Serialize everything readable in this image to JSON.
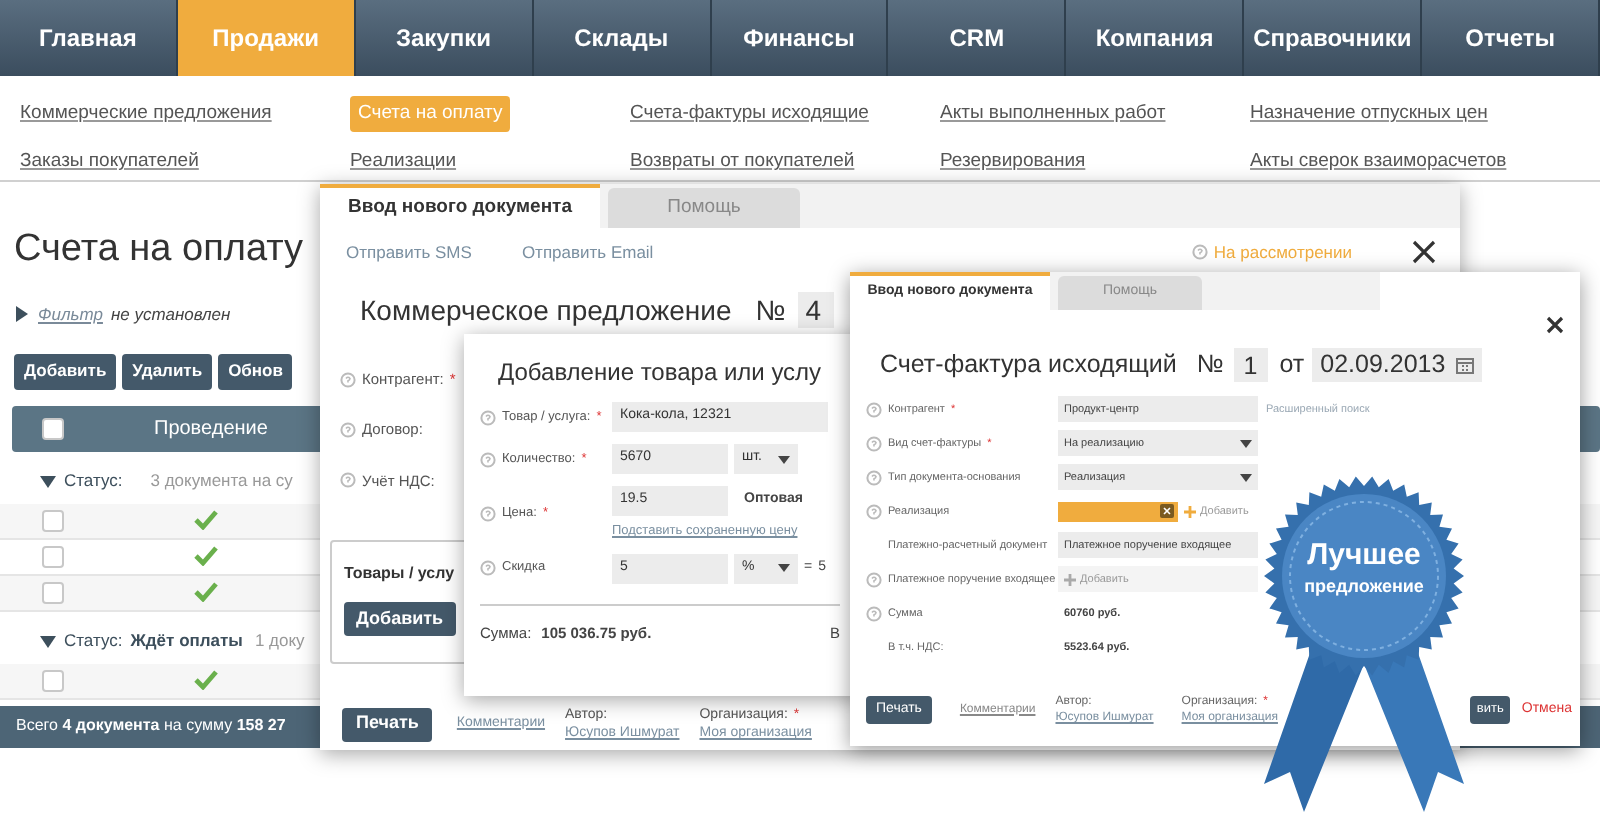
{
  "nav": [
    {
      "label": "Главная",
      "selected": false
    },
    {
      "label": "Продажи",
      "selected": true
    },
    {
      "label": "Закупки",
      "selected": false
    },
    {
      "label": "Склады",
      "selected": false
    },
    {
      "label": "Финансы",
      "selected": false
    },
    {
      "label": "CRM",
      "selected": false
    },
    {
      "label": "Компания",
      "selected": false
    },
    {
      "label": "Справочники",
      "selected": false
    },
    {
      "label": "Отчеты",
      "selected": false
    }
  ],
  "subnav": [
    {
      "label": "Коммерческие предложения",
      "selected": false
    },
    {
      "label": "Счета на оплату",
      "selected": true
    },
    {
      "label": "Счета-фактуры исходящие",
      "selected": false
    },
    {
      "label": "Акты выполненных работ",
      "selected": false
    },
    {
      "label": "Назначение отпускных цен",
      "selected": false
    },
    {
      "label": "Заказы покупателей",
      "selected": false
    },
    {
      "label": "Реализации",
      "selected": false
    },
    {
      "label": "Возвраты от покупателей",
      "selected": false
    },
    {
      "label": "Резервирования",
      "selected": false
    },
    {
      "label": "Акты сверок взаиморасчетов",
      "selected": false
    }
  ],
  "page": {
    "title": "Счета на оплату",
    "filter": {
      "expanded": false,
      "link": "Фильтр",
      "text": "не установлен"
    },
    "buttons": [
      "Добавить",
      "Удалить",
      "Обнов"
    ],
    "table": {
      "header_checked": false,
      "column": "Проведение",
      "groups": [
        {
          "expanded": true,
          "label": "Статус:",
          "summary": "3 документа на су",
          "rows": [
            {
              "checked": false,
              "posted": true
            },
            {
              "checked": false,
              "posted": true
            },
            {
              "checked": false,
              "posted": true
            }
          ]
        },
        {
          "expanded": true,
          "label": "Статус:",
          "value": "Ждёт оплаты",
          "summary": "1 доку",
          "rows": [
            {
              "checked": false,
              "posted": true
            }
          ]
        }
      ]
    },
    "footer": "Всего **4 документа** на сумму **158 27**"
  },
  "offer_window": {
    "tabs": [
      {
        "label": "Ввод нового документа",
        "selected": true
      },
      {
        "label": "Помощь",
        "selected": false
      }
    ],
    "links": [
      "Отправить SMS",
      "Отправить Email"
    ],
    "status": "На рассмотрении",
    "title": "Коммерческое предложение",
    "number_label": "№",
    "number": "4",
    "fields": [
      {
        "label": "Контрагент:",
        "required": true,
        "mark": "*"
      },
      {
        "label": "Договор:",
        "required": false
      },
      {
        "label": "Учёт НДС:",
        "required": false
      }
    ],
    "section_title": "Товары / услу",
    "section_button": "Добавить",
    "print_button": "Печать",
    "comments_link": "Комментарии",
    "author_label": "Автор:",
    "author": "Юсупов Ишмурат",
    "org_label": "Организация:",
    "org_required": true,
    "org_mark": "*",
    "org": "Моя организация"
  },
  "add_item_dialog": {
    "title": "Добавление товара или услу",
    "fields": [
      {
        "kind": "text",
        "label": "Товар / услуга:",
        "required": true,
        "mark": "*",
        "value": "Кока-кола, 12321"
      },
      {
        "kind": "quantity",
        "label": "Количество:",
        "required": true,
        "mark": "*",
        "value": "5670",
        "unit": "шт."
      },
      {
        "kind": "price",
        "label": "Цена:",
        "required": true,
        "mark": "*",
        "value": "19.5",
        "price_type": "Оптовая",
        "link": "Подставить сохраненную цену"
      },
      {
        "kind": "discount",
        "label": "Скидка",
        "required": false,
        "value": "5",
        "unit": "%",
        "equals": "=",
        "result": "5"
      }
    ],
    "sum_label": "Сумма:",
    "sum": "105 036.75 руб.",
    "extra": "В"
  },
  "invoice_window": {
    "tabs": [
      {
        "label": "Ввод нового документа",
        "selected": true
      },
      {
        "label": "Помощь",
        "selected": false
      }
    ],
    "title": "Счет-фактура исходящий",
    "number_label": "№",
    "number": "1",
    "date_label": "от",
    "date": "02.09.2013",
    "fields": [
      {
        "kind": "text",
        "help": true,
        "label": "Контрагент",
        "required": true,
        "mark": "*",
        "value": "Продукт-центр",
        "link": "Расширенный поиск"
      },
      {
        "kind": "select",
        "help": true,
        "label": "Вид счет-фактуры",
        "required": true,
        "mark": "*",
        "value": "На реализацию"
      },
      {
        "kind": "select",
        "help": true,
        "label": "Тип документа-основания",
        "required": false,
        "value": "Реализация"
      },
      {
        "kind": "tags",
        "help": true,
        "label": "Реализация",
        "required": false,
        "add": "Добавить"
      },
      {
        "kind": "text",
        "help": false,
        "label": "Платежно-расчетный документ",
        "required": false,
        "value": "Платежное поручение входящее"
      },
      {
        "kind": "add",
        "help": true,
        "label": "Платежное поручение входящее",
        "required": false,
        "add": "Добавить"
      },
      {
        "kind": "static",
        "help": true,
        "label": "Сумма",
        "required": false,
        "value": "60760 руб."
      },
      {
        "kind": "static",
        "help": false,
        "label": "В т.ч. НДС:",
        "required": false,
        "value": "5523.64 руб."
      }
    ],
    "print_button": "Печать",
    "comments_link": "Комментарии",
    "author_label": "Автор:",
    "author": "Юсупов Ишмурат",
    "org_label": "Организация:",
    "org_required": true,
    "org_mark": "*",
    "org": "Моя организация",
    "save_button": "вить",
    "cancel_link": "Отмена"
  },
  "badge": {
    "line_1": "Лучшее",
    "line_2": "предложение"
  }
}
